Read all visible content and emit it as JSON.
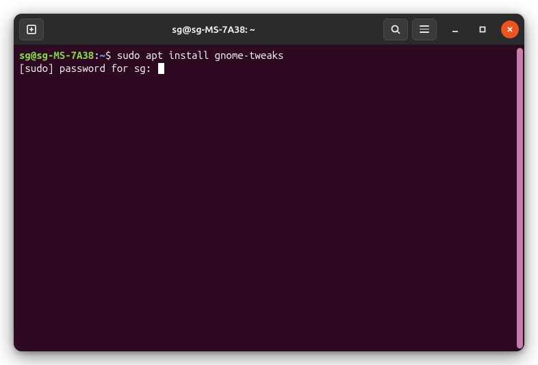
{
  "titlebar": {
    "title": "sg@sg-MS-7A38: ~"
  },
  "terminal": {
    "prompt": {
      "user_host": "sg@sg-MS-7A38",
      "separator": ":",
      "path": "~",
      "symbol": "$ "
    },
    "command": "sudo apt install gnome-tweaks",
    "output_line": "[sudo] password for sg: "
  }
}
